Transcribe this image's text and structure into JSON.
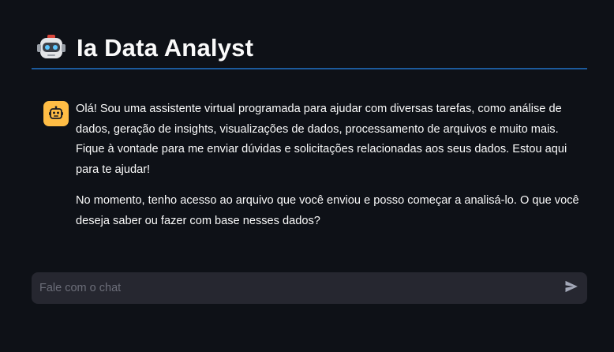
{
  "header": {
    "title": "Ia Data Analyst",
    "logo_icon": "robot-face-icon"
  },
  "colors": {
    "background": "#0e1117",
    "divider": "#1c5a9c",
    "avatar": "#ffbd45",
    "input_background": "#262730"
  },
  "chat": {
    "messages": [
      {
        "role": "assistant",
        "avatar_icon": "bot-icon",
        "paragraphs": [
          "Olá! Sou uma assistente virtual programada para ajudar com diversas tarefas, como análise de dados, geração de insights, visualizações de dados, processamento de arquivos e muito mais. Fique à vontade para me enviar dúvidas e solicitações relacionadas aos seus dados. Estou aqui para te ajudar!",
          "No momento, tenho acesso ao arquivo que você enviou e posso começar a analisá-lo. O que você deseja saber ou fazer com base nesses dados?"
        ]
      }
    ],
    "input": {
      "placeholder": "Fale com o chat",
      "value": ""
    },
    "send_icon": "send-icon"
  }
}
